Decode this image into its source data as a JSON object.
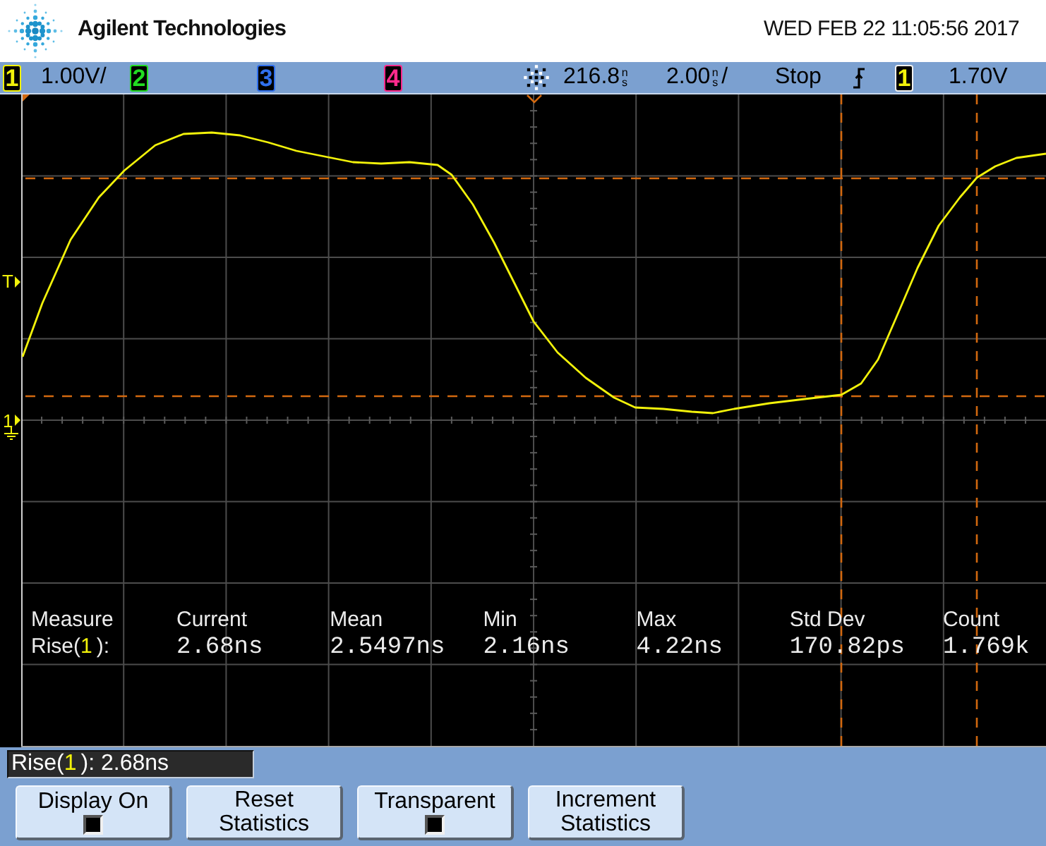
{
  "header": {
    "brand": "Agilent Technologies",
    "datetime": "WED FEB 22 11:05:56 2017"
  },
  "status_bar": {
    "channels": [
      {
        "label": "1",
        "color": "#f2f20a",
        "scale": "1.00V/"
      },
      {
        "label": "2",
        "color": "#22dd22"
      },
      {
        "label": "3",
        "color": "#3070ee"
      },
      {
        "label": "4",
        "color": "#ff2a8c"
      }
    ],
    "time_reference": {
      "value": "216.8",
      "unit": "ns"
    },
    "time_scale": {
      "value": "2.00",
      "unit": "ns",
      "suffix": "/"
    },
    "run_state": "Stop",
    "trigger": {
      "source": "1",
      "level": "1.70V"
    }
  },
  "display": {
    "markers": [
      {
        "kind": "trigger_level",
        "label": "T"
      },
      {
        "kind": "ground",
        "label": "1"
      }
    ],
    "measurements": {
      "title": "Measure",
      "source": {
        "name": "Rise(",
        "channel": "1",
        "suffix": "):"
      },
      "columns": [
        {
          "heading": "Current",
          "value": "2.68ns"
        },
        {
          "heading": "Mean",
          "value": "2.5497ns"
        },
        {
          "heading": "Min",
          "value": "2.16ns"
        },
        {
          "heading": "Max",
          "value": "4.22ns"
        },
        {
          "heading": "Std Dev",
          "value": "170.82ps"
        },
        {
          "heading": "Count",
          "value": "1.769k"
        }
      ]
    }
  },
  "message": {
    "name": "Rise(",
    "channel": "1",
    "suffix": "): 2.68ns"
  },
  "softkeys": [
    {
      "kind": "toggle",
      "label": "Display On",
      "checked": true
    },
    {
      "kind": "action",
      "label": "Reset Statistics"
    },
    {
      "kind": "toggle",
      "label": "Transparent",
      "checked": true
    },
    {
      "kind": "action",
      "label": "Increment Statistics"
    }
  ]
}
